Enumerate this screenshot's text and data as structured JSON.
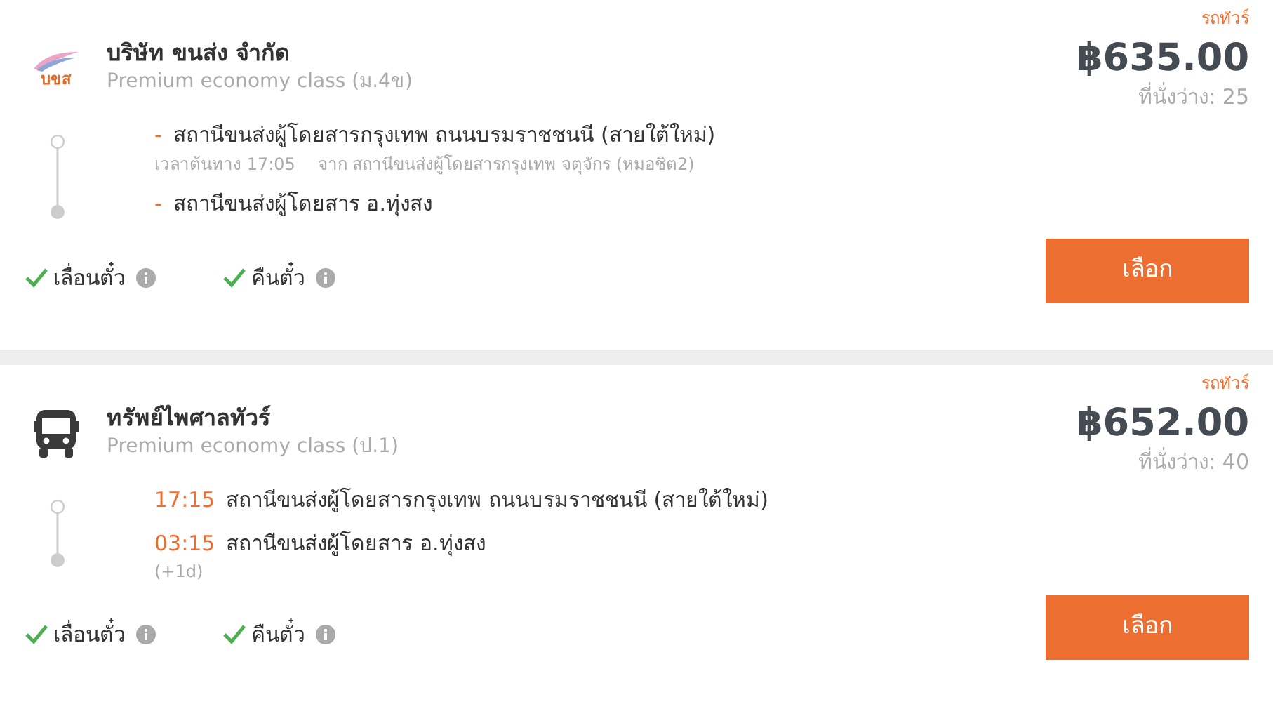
{
  "trips": [
    {
      "tag": "รถทัวร์",
      "logo": {
        "kind": "brand",
        "text": "บขส"
      },
      "operator": "บริษัท ขนส่ง จำกัด",
      "class": "Premium economy class (ม.4ข)",
      "price": "฿635.00",
      "seats": "ที่นั่งว่าง: 25",
      "stops": [
        {
          "marker": "-",
          "name": "สถานีขนส่งผู้โดยสารกรุงเทพ ถนนบรมราชชนนี (สายใต้ใหม่)",
          "notes": [
            "เวลาต้นทาง 17:05",
            "จาก สถานีขนส่งผู้โดยสารกรุงเทพ จตุจักร (หมอชิต2)"
          ]
        },
        {
          "marker": "-",
          "name": "สถานีขนส่งผู้โดยสาร อ.ทุ่งสง"
        }
      ],
      "features": [
        {
          "label": "เลื่อนตั๋ว",
          "checked": true
        },
        {
          "label": "คืนตั๋ว",
          "checked": true
        }
      ],
      "button": "เลือก"
    },
    {
      "tag": "รถทัวร์",
      "logo": {
        "kind": "bus"
      },
      "operator": "ทรัพย์ไพศาลทัวร์",
      "class": "Premium economy class (ป.1)",
      "price": "฿652.00",
      "seats": "ที่นั่งว่าง: 40",
      "stops": [
        {
          "time": "17:15",
          "name": "สถานีขนส่งผู้โดยสารกรุงเทพ ถนนบรมราชชนนี (สายใต้ใหม่)"
        },
        {
          "time": "03:15",
          "name": "สถานีขนส่งผู้โดยสาร อ.ทุ่งสง",
          "notes": [
            "(+1d)"
          ]
        }
      ],
      "features": [
        {
          "label": "เลื่อนตั๋ว",
          "checked": true
        },
        {
          "label": "คืนตั๋ว",
          "checked": true
        }
      ],
      "button": "เลือก"
    }
  ]
}
